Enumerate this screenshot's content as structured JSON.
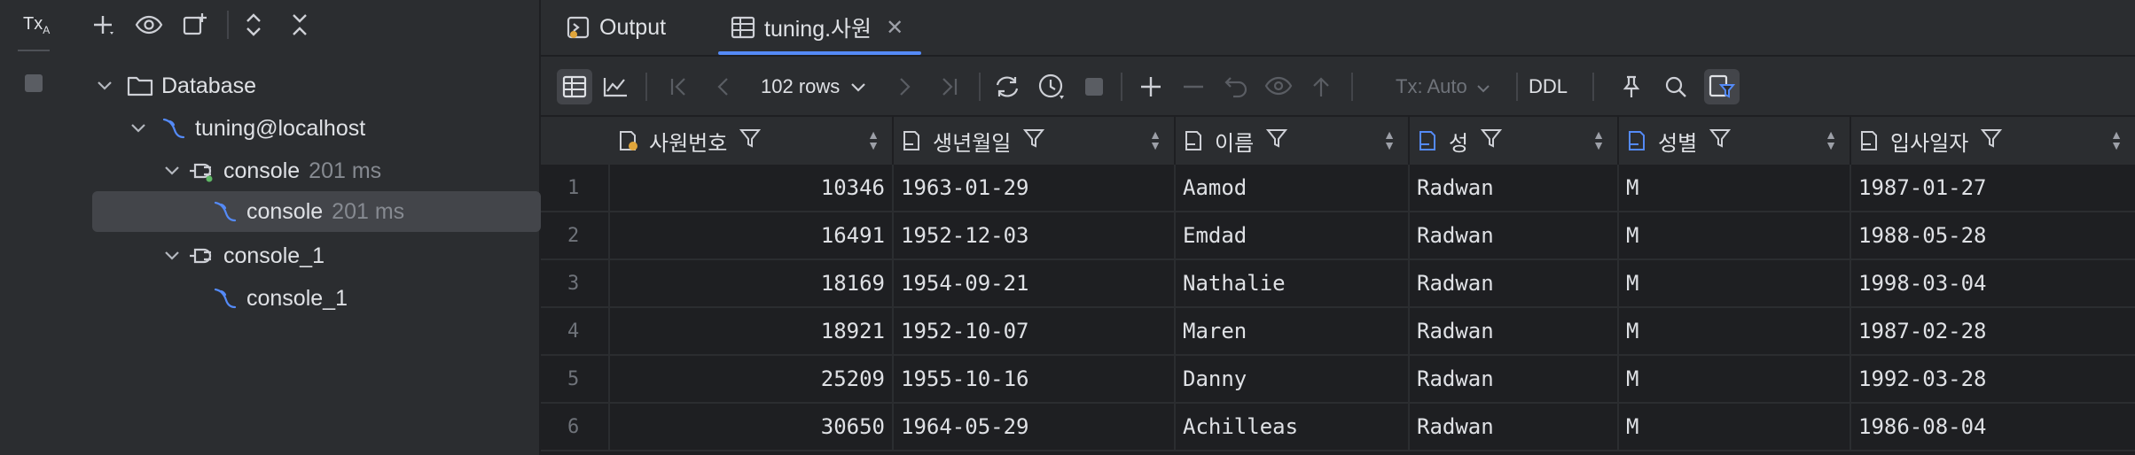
{
  "side_strip": {
    "tx_label": "Tx",
    "tx_sub": "A"
  },
  "tree": {
    "items": [
      {
        "label": "Database",
        "meta": ""
      },
      {
        "label": "tuning@localhost",
        "meta": ""
      },
      {
        "label": "console",
        "meta": "201 ms"
      },
      {
        "label": "console",
        "meta": "201 ms"
      },
      {
        "label": "console_1",
        "meta": ""
      },
      {
        "label": "console_1",
        "meta": ""
      }
    ]
  },
  "tabs": [
    {
      "label": "Output"
    },
    {
      "label": "tuning.사원"
    }
  ],
  "toolbar": {
    "rows_label": "102 rows",
    "tx_label": "Tx: Auto",
    "ddl_label": "DDL"
  },
  "table": {
    "columns": [
      "사원번호",
      "생년월일",
      "이름",
      "성",
      "성별",
      "입사일자"
    ],
    "rows": [
      [
        "1",
        "10346",
        "1963-01-29",
        "Aamod",
        "Radwan",
        "M",
        "1987-01-27"
      ],
      [
        "2",
        "16491",
        "1952-12-03",
        "Emdad",
        "Radwan",
        "M",
        "1988-05-28"
      ],
      [
        "3",
        "18169",
        "1954-09-21",
        "Nathalie",
        "Radwan",
        "M",
        "1998-03-04"
      ],
      [
        "4",
        "18921",
        "1952-10-07",
        "Maren",
        "Radwan",
        "M",
        "1987-02-28"
      ],
      [
        "5",
        "25209",
        "1955-10-16",
        "Danny",
        "Radwan",
        "M",
        "1992-03-28"
      ],
      [
        "6",
        "30650",
        "1964-05-29",
        "Achilleas",
        "Radwan",
        "M",
        "1986-08-04"
      ]
    ]
  },
  "colors": {
    "accent": "#548af7",
    "panel": "#2b2d30",
    "background": "#1e1f22",
    "selection": "#43454a"
  }
}
